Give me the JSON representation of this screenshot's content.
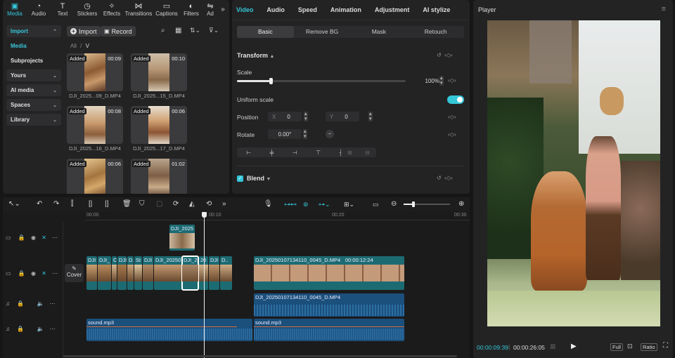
{
  "media_tabs": [
    {
      "label": "Media",
      "icon": "media-icon"
    },
    {
      "label": "Audio",
      "icon": "audio-icon"
    },
    {
      "label": "Text",
      "icon": "text-icon"
    },
    {
      "label": "Stickers",
      "icon": "stickers-icon"
    },
    {
      "label": "Effects",
      "icon": "effects-icon"
    },
    {
      "label": "Transitions",
      "icon": "transitions-icon"
    },
    {
      "label": "Captions",
      "icon": "captions-icon"
    },
    {
      "label": "Filters",
      "icon": "filters-icon"
    },
    {
      "label": "Ad",
      "icon": "adjust-icon"
    }
  ],
  "sidebar": {
    "import": "Import",
    "media": "Media",
    "subprojects": "Subprojects",
    "yours": "Yours",
    "ai_media": "AI media",
    "spaces": "Spaces",
    "library": "Library"
  },
  "media_toolbar": {
    "import": "Import",
    "record": "Record"
  },
  "breadcrumb": {
    "all": "All",
    "slash": "/",
    "current": "V"
  },
  "media_items": [
    {
      "badge": "Added",
      "duration": "00:09",
      "name": "DJI_2025...09_D.MP4"
    },
    {
      "badge": "Added",
      "duration": "00:10",
      "name": "DJI_2025...15_D.MP4"
    },
    {
      "badge": "Added",
      "duration": "00:08",
      "name": "DJI_2025...16_D.MP4"
    },
    {
      "badge": "Added",
      "duration": "00:06",
      "name": "DJI_2025...17_D.MP4"
    },
    {
      "badge": "Added",
      "duration": "00:06",
      "name": ""
    },
    {
      "badge": "Added",
      "duration": "01:02",
      "name": ""
    }
  ],
  "props_tabs": [
    "Video",
    "Audio",
    "Speed",
    "Animation",
    "Adjustment",
    "AI stylize"
  ],
  "props_subtabs": [
    "Basic",
    "Remove BG",
    "Mask",
    "Retouch"
  ],
  "transform": {
    "section": "Transform",
    "scale_label": "Scale",
    "scale_value": "100%",
    "scale_fraction": 0.2,
    "uniform_label": "Uniform scale",
    "uniform_on": true,
    "position_label": "Position",
    "x_label": "X",
    "x_value": "0",
    "y_label": "Y",
    "y_value": "0",
    "rotate_label": "Rotate",
    "rotate_value": "0.00°"
  },
  "blend": {
    "label": "Blend"
  },
  "player": {
    "title": "Player",
    "current_time": "00:00:09:39",
    "total_time": "00:00:26:05",
    "full": "Full",
    "ratio": "Ratio"
  },
  "ruler": [
    "00:00",
    "00:10",
    "00:20",
    "00:30"
  ],
  "cover_label": "Cover",
  "clips": {
    "overlay": "DJI_2025",
    "main_titles": [
      "DJI",
      "DJI_",
      "C",
      "DJI",
      "D.",
      "St",
      "DJI",
      "DJI_20250",
      "DJI_2",
      "20",
      "DJI",
      "D.."
    ],
    "long_clip": "DJI_20250107134110_0045_D.MP4",
    "long_clip_dur": "00:00:12:24",
    "audio_clip": "DJI_20250107134110_0045_D.MP4",
    "sound1": "sound.mp3",
    "sound2": "sound.mp3"
  },
  "colors": {
    "accent": "#35c6d8",
    "clip_teal": "#1c6b73",
    "audio_blue": "#1b4f7c"
  }
}
